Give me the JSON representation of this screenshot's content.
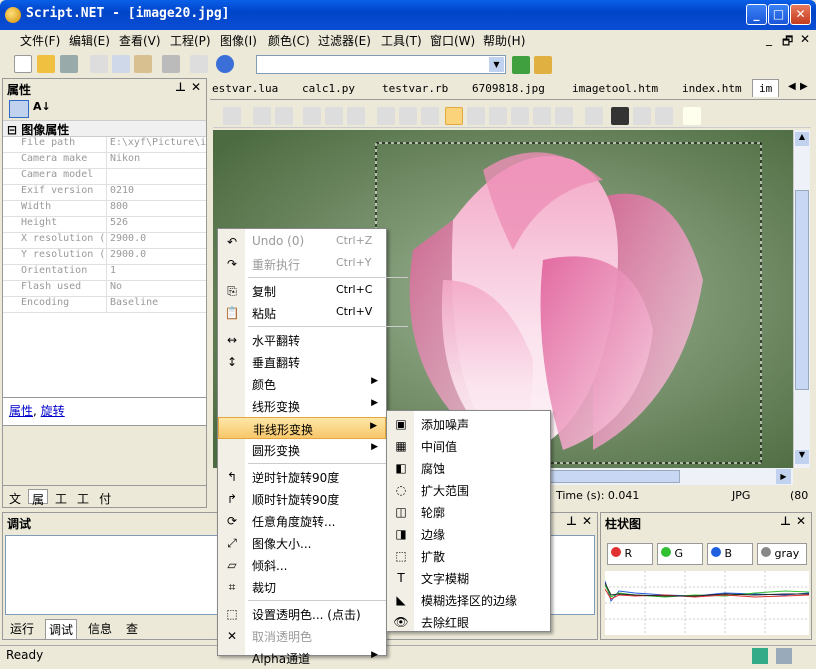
{
  "window": {
    "title": "Script.NET - [image20.jpg]",
    "min": "_",
    "max": "□",
    "close": "✕"
  },
  "menubar": [
    "文件(F)",
    "编辑(E)",
    "查看(V)",
    "工程(P)",
    "图像(I)",
    "颜色(C)",
    "过滤器(E)",
    "工具(T)",
    "窗口(W)",
    "帮助(H)"
  ],
  "mdi_controls": [
    "_",
    "🗗",
    "✕"
  ],
  "properties": {
    "title": "属性",
    "group": "图像属性",
    "rows": [
      {
        "k": "File path",
        "v": "E:\\xyf\\Picture\\i"
      },
      {
        "k": "Camera make",
        "v": "Nikon"
      },
      {
        "k": "Camera model",
        "v": ""
      },
      {
        "k": "Exif version",
        "v": "0210"
      },
      {
        "k": "Width",
        "v": "800"
      },
      {
        "k": "Height",
        "v": "526"
      },
      {
        "k": "X resolution (",
        "v": "2900.0"
      },
      {
        "k": "Y resolution (",
        "v": "2900.0"
      },
      {
        "k": "Orientation",
        "v": "1"
      },
      {
        "k": "Flash used",
        "v": "No"
      },
      {
        "k": "Encoding",
        "v": "Baseline"
      }
    ],
    "links": [
      "属性",
      "旋转"
    ],
    "link_sep": ",",
    "bottom_tabs": [
      "文",
      "属",
      "工",
      "工",
      "付"
    ]
  },
  "doc_tabs": [
    "estvar.lua",
    "calc1.py",
    "testvar.rb",
    "6709818.jpg",
    "imagetool.htm",
    "index.htm",
    "im"
  ],
  "status_mid": {
    "time": "Time (s): 0.041",
    "type": "JPG",
    "dim": "(80"
  },
  "debug": {
    "title": "调试",
    "tabs": [
      "运行",
      "调试",
      "信息",
      "查"
    ]
  },
  "histogram": {
    "title": "柱状图",
    "channels": [
      "R",
      "G",
      "B",
      "gray"
    ],
    "colors": [
      "#e03030",
      "#30c030",
      "#2060e0",
      "#808080"
    ]
  },
  "statusbar": {
    "text": "Ready"
  },
  "context_menu": [
    {
      "icon": "undo-icon",
      "glyph": "↶",
      "label": "Undo (0)",
      "shortcut": "Ctrl+Z",
      "disabled": true
    },
    {
      "icon": "redo-icon",
      "glyph": "↷",
      "label": "重新执行",
      "shortcut": "Ctrl+Y",
      "disabled": true
    },
    {
      "sep": true
    },
    {
      "icon": "copy-icon",
      "glyph": "⎘",
      "label": "复制",
      "shortcut": "Ctrl+C"
    },
    {
      "icon": "paste-icon",
      "glyph": "📋",
      "label": "粘贴",
      "shortcut": "Ctrl+V"
    },
    {
      "sep": true
    },
    {
      "icon": "flip-horizontal-icon",
      "glyph": "↔",
      "label": "水平翻转"
    },
    {
      "icon": "flip-vertical-icon",
      "glyph": "↕",
      "label": "垂直翻转"
    },
    {
      "label": "颜色",
      "submenu": true
    },
    {
      "label": "线形变换",
      "submenu": true
    },
    {
      "label": "非线形变换",
      "submenu": true,
      "selected": true
    },
    {
      "label": "圆形变换",
      "submenu": true
    },
    {
      "sep": true
    },
    {
      "icon": "rotate-ccw-icon",
      "glyph": "↰",
      "label": "逆时针旋转90度"
    },
    {
      "icon": "rotate-cw-icon",
      "glyph": "↱",
      "label": "顺时针旋转90度"
    },
    {
      "icon": "rotate-any-icon",
      "glyph": "⟳",
      "label": "任意角度旋转..."
    },
    {
      "icon": "resize-icon",
      "glyph": "⤢",
      "label": "图像大小..."
    },
    {
      "icon": "skew-icon",
      "glyph": "▱",
      "label": "倾斜..."
    },
    {
      "icon": "crop-icon",
      "glyph": "⌗",
      "label": "裁切"
    },
    {
      "sep": true
    },
    {
      "icon": "transparent-icon",
      "glyph": "⬚",
      "label": "设置透明色... (点击)"
    },
    {
      "icon": "cancel-transparent-icon",
      "glyph": "✕",
      "label": "取消透明色",
      "disabled": true
    },
    {
      "label": "Alpha通道",
      "submenu": true
    }
  ],
  "submenu": [
    {
      "icon": "noise-icon",
      "glyph": "▣",
      "label": "添加噪声"
    },
    {
      "icon": "median-icon",
      "glyph": "▦",
      "label": "中间值"
    },
    {
      "icon": "erode-icon",
      "glyph": "◧",
      "label": "腐蚀"
    },
    {
      "icon": "dilate-icon",
      "glyph": "◌",
      "label": "扩大范围"
    },
    {
      "icon": "contour-icon",
      "glyph": "◫",
      "label": "轮廓"
    },
    {
      "icon": "edge-icon",
      "glyph": "◨",
      "label": "边缘"
    },
    {
      "icon": "diffuse-icon",
      "glyph": "⬚",
      "label": "扩散"
    },
    {
      "icon": "text-blur-icon",
      "glyph": "T",
      "label": "文字模糊"
    },
    {
      "icon": "blur-selection-edge-icon",
      "glyph": "◣",
      "label": "模糊选择区的边缘"
    },
    {
      "icon": "red-eye-icon",
      "glyph": "👁",
      "label": "去除红眼"
    }
  ]
}
